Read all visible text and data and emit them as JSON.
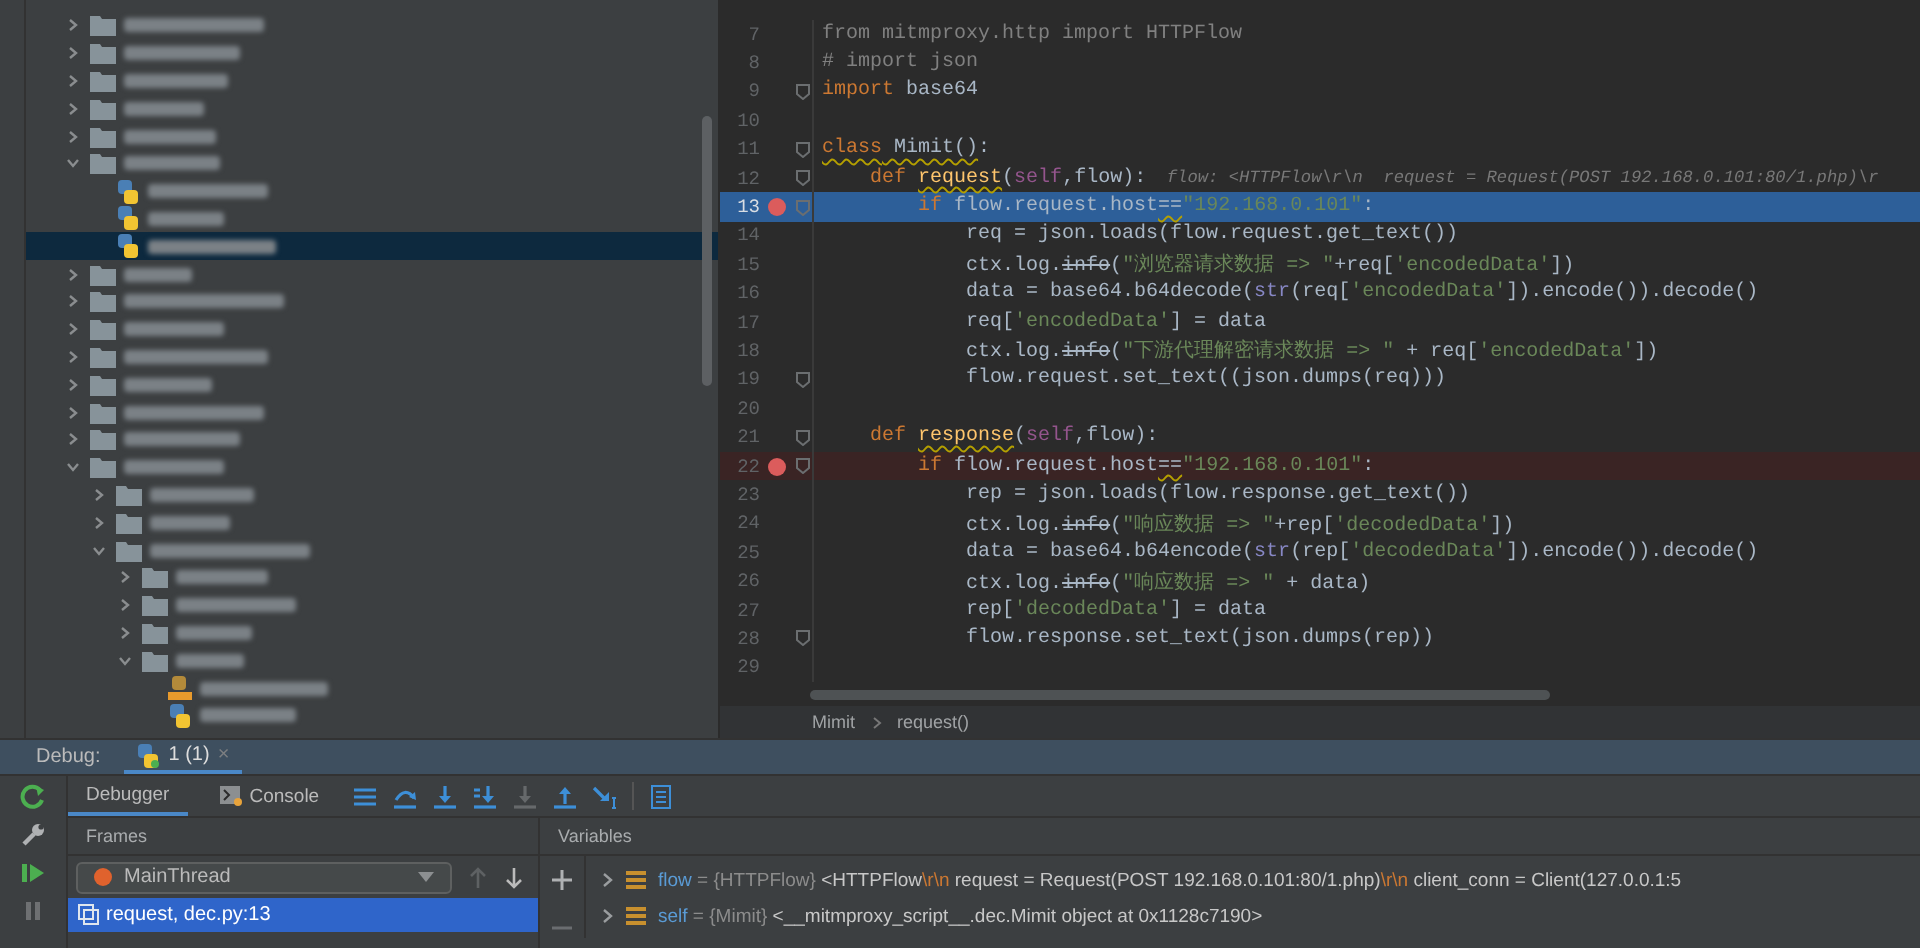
{
  "project_tree": {
    "items": [
      {
        "kind": "folder",
        "expanded": false,
        "selected": false
      },
      {
        "kind": "folder",
        "expanded": false,
        "selected": false
      },
      {
        "kind": "folder",
        "expanded": false,
        "selected": false
      },
      {
        "kind": "folder",
        "expanded": false,
        "selected": false
      },
      {
        "kind": "folder",
        "expanded": false,
        "selected": false
      },
      {
        "kind": "folder",
        "expanded": true,
        "selected": false,
        "children": [
          {
            "kind": "python-file",
            "selected": false
          },
          {
            "kind": "python-file",
            "selected": false
          },
          {
            "kind": "python-file",
            "selected": true
          }
        ]
      },
      {
        "kind": "folder",
        "expanded": false,
        "selected": false
      },
      {
        "kind": "folder",
        "expanded": false,
        "selected": false
      },
      {
        "kind": "folder",
        "expanded": false,
        "selected": false
      },
      {
        "kind": "folder",
        "expanded": false,
        "selected": false
      },
      {
        "kind": "folder",
        "expanded": false,
        "selected": false
      },
      {
        "kind": "folder",
        "expanded": false,
        "selected": false
      },
      {
        "kind": "folder",
        "expanded": false,
        "selected": false
      },
      {
        "kind": "folder",
        "expanded": true,
        "selected": false,
        "children": [
          {
            "kind": "folder",
            "expanded": false,
            "selected": false
          },
          {
            "kind": "folder",
            "expanded": false,
            "selected": false
          },
          {
            "kind": "folder",
            "expanded": true,
            "selected": false,
            "children": [
              {
                "kind": "folder",
                "expanded": false,
                "selected": false
              },
              {
                "kind": "folder",
                "expanded": false,
                "selected": false
              },
              {
                "kind": "folder",
                "expanded": false,
                "selected": false
              },
              {
                "kind": "folder",
                "expanded": true,
                "selected": false,
                "children": [
                  {
                    "kind": "module-file",
                    "selected": false
                  },
                  {
                    "kind": "python-file",
                    "selected": false
                  }
                ]
              }
            ]
          }
        ]
      }
    ]
  },
  "editor": {
    "lines": [
      {
        "number": "7",
        "breakpoint": false,
        "current": false,
        "fold": false,
        "tokens": [
          {
            "t": "from mitmproxy.http import HTTPFlow",
            "kind": "unused"
          }
        ]
      },
      {
        "number": "8",
        "breakpoint": false,
        "current": false,
        "fold": false,
        "tokens": [
          {
            "t": "# import json",
            "kind": "comment"
          }
        ]
      },
      {
        "number": "9",
        "breakpoint": false,
        "current": false,
        "fold": true,
        "tokens": [
          {
            "t": "import",
            "kind": "kw"
          },
          {
            "t": " base64",
            "kind": "plain"
          }
        ]
      },
      {
        "number": "10",
        "breakpoint": false,
        "current": false,
        "fold": false
      },
      {
        "number": "11",
        "breakpoint": false,
        "current": false,
        "fold": true,
        "tokens": [
          {
            "t": "class",
            "kind": "kw",
            "wavy": true
          },
          {
            "t": " Mimit()",
            "kind": "plain",
            "wavy": true
          },
          {
            "t": ":",
            "kind": "plain"
          }
        ]
      },
      {
        "number": "12",
        "breakpoint": false,
        "current": false,
        "fold": true,
        "tokens": [
          {
            "t": "    def ",
            "kind": "kw"
          },
          {
            "t": "request",
            "kind": "fn",
            "wavy": true
          },
          {
            "t": "(",
            "kind": "plain"
          },
          {
            "t": "self",
            "kind": "self"
          },
          {
            "t": ",flow):",
            "kind": "plain"
          },
          {
            "t": "  flow: <HTTPFlow\\r\\n  request = Request(POST 192.168.0.101:80/1.php)\\r",
            "kind": "hint"
          }
        ]
      },
      {
        "number": "13",
        "breakpoint": true,
        "current": true,
        "fold": true,
        "tokens": [
          {
            "t": "        if",
            "kind": "kw"
          },
          {
            "t": " flow.request.host",
            "kind": "plain"
          },
          {
            "t": "==",
            "kind": "plain",
            "wavy": true
          },
          {
            "t": "\"192.168.0.101\"",
            "kind": "str"
          },
          {
            "t": ":",
            "kind": "plain"
          }
        ]
      },
      {
        "number": "14",
        "breakpoint": false,
        "current": false,
        "fold": false,
        "tokens": [
          {
            "t": "            req = json.loads(flow.request.get_text())",
            "kind": "plain"
          }
        ]
      },
      {
        "number": "15",
        "breakpoint": false,
        "current": false,
        "fold": false,
        "tokens": [
          {
            "t": "            ctx.log.",
            "kind": "plain"
          },
          {
            "t": "info",
            "kind": "strike"
          },
          {
            "t": "(",
            "kind": "plain"
          },
          {
            "t": "\"浏览器请求数据 => \"",
            "kind": "str"
          },
          {
            "t": "+req[",
            "kind": "plain"
          },
          {
            "t": "'encodedData'",
            "kind": "str"
          },
          {
            "t": "])",
            "kind": "plain"
          }
        ]
      },
      {
        "number": "16",
        "breakpoint": false,
        "current": false,
        "fold": false,
        "tokens": [
          {
            "t": "            data = base64.b64decode(",
            "kind": "plain"
          },
          {
            "t": "str",
            "kind": "builtin"
          },
          {
            "t": "(req[",
            "kind": "plain"
          },
          {
            "t": "'encodedData'",
            "kind": "str"
          },
          {
            "t": "]).encode()).decode()",
            "kind": "plain"
          }
        ]
      },
      {
        "number": "17",
        "breakpoint": false,
        "current": false,
        "fold": false,
        "tokens": [
          {
            "t": "            req[",
            "kind": "plain"
          },
          {
            "t": "'encodedData'",
            "kind": "str"
          },
          {
            "t": "] = data",
            "kind": "plain"
          }
        ]
      },
      {
        "number": "18",
        "breakpoint": false,
        "current": false,
        "fold": false,
        "tokens": [
          {
            "t": "            ctx.log.",
            "kind": "plain"
          },
          {
            "t": "info",
            "kind": "strike"
          },
          {
            "t": "(",
            "kind": "plain"
          },
          {
            "t": "\"下游代理解密请求数据 => \"",
            "kind": "str"
          },
          {
            "t": " + req[",
            "kind": "plain"
          },
          {
            "t": "'encodedData'",
            "kind": "str"
          },
          {
            "t": "])",
            "kind": "plain"
          }
        ]
      },
      {
        "number": "19",
        "breakpoint": false,
        "current": false,
        "fold": true,
        "tokens": [
          {
            "t": "            flow.request.set_text((json.dumps(req)))",
            "kind": "plain"
          }
        ]
      },
      {
        "number": "20",
        "breakpoint": false,
        "current": false,
        "fold": false
      },
      {
        "number": "21",
        "breakpoint": false,
        "current": false,
        "fold": true,
        "tokens": [
          {
            "t": "    def ",
            "kind": "kw"
          },
          {
            "t": "response",
            "kind": "fn",
            "wavy": true
          },
          {
            "t": "(",
            "kind": "plain"
          },
          {
            "t": "self",
            "kind": "self"
          },
          {
            "t": ",flow):",
            "kind": "plain"
          }
        ]
      },
      {
        "number": "22",
        "breakpoint": true,
        "current": false,
        "fold": true,
        "tokens": [
          {
            "t": "        if",
            "kind": "kw"
          },
          {
            "t": " flow.request.host",
            "kind": "plain"
          },
          {
            "t": "==",
            "kind": "plain",
            "wavy": true
          },
          {
            "t": "\"192.168.0.101\"",
            "kind": "str"
          },
          {
            "t": ":",
            "kind": "plain"
          }
        ]
      },
      {
        "number": "23",
        "breakpoint": false,
        "current": false,
        "fold": false,
        "tokens": [
          {
            "t": "            rep = json.loads(flow.response.get_text())",
            "kind": "plain"
          }
        ]
      },
      {
        "number": "24",
        "breakpoint": false,
        "current": false,
        "fold": false,
        "tokens": [
          {
            "t": "            ctx.log.",
            "kind": "plain"
          },
          {
            "t": "info",
            "kind": "strike"
          },
          {
            "t": "(",
            "kind": "plain"
          },
          {
            "t": "\"响应数据 => \"",
            "kind": "str"
          },
          {
            "t": "+rep[",
            "kind": "plain"
          },
          {
            "t": "'decodedData'",
            "kind": "str"
          },
          {
            "t": "])",
            "kind": "plain"
          }
        ]
      },
      {
        "number": "25",
        "breakpoint": false,
        "current": false,
        "fold": false,
        "tokens": [
          {
            "t": "            data = base64.b64encode(",
            "kind": "plain"
          },
          {
            "t": "str",
            "kind": "builtin"
          },
          {
            "t": "(rep[",
            "kind": "plain"
          },
          {
            "t": "'decodedData'",
            "kind": "str"
          },
          {
            "t": "]).encode()).decode()",
            "kind": "plain"
          }
        ]
      },
      {
        "number": "26",
        "breakpoint": false,
        "current": false,
        "fold": false,
        "tokens": [
          {
            "t": "            ctx.log.",
            "kind": "plain"
          },
          {
            "t": "info",
            "kind": "strike"
          },
          {
            "t": "(",
            "kind": "plain"
          },
          {
            "t": "\"响应数据 => \"",
            "kind": "str"
          },
          {
            "t": " + data)",
            "kind": "plain"
          }
        ]
      },
      {
        "number": "27",
        "breakpoint": false,
        "current": false,
        "fold": false,
        "tokens": [
          {
            "t": "            rep[",
            "kind": "plain"
          },
          {
            "t": "'decodedData'",
            "kind": "str"
          },
          {
            "t": "] = data",
            "kind": "plain"
          }
        ]
      },
      {
        "number": "28",
        "breakpoint": false,
        "current": false,
        "fold": true,
        "tokens": [
          {
            "t": "            flow.response.set_text(json.dumps(rep))",
            "kind": "plain"
          }
        ]
      },
      {
        "number": "29",
        "breakpoint": false,
        "current": false,
        "fold": false
      }
    ],
    "breadcrumbs": [
      "Mimit",
      "request()"
    ]
  },
  "debug": {
    "label": "Debug:",
    "session_tab": {
      "label": "1 (1)",
      "close": "×"
    },
    "tabs": [
      {
        "label": "Debugger",
        "selected": true
      },
      {
        "label": "Console",
        "selected": false
      }
    ],
    "toolbar": [
      {
        "kind": "frames",
        "disabled": false
      },
      {
        "kind": "step-over",
        "disabled": false
      },
      {
        "kind": "step-into",
        "disabled": false
      },
      {
        "kind": "step-into-my-code",
        "disabled": false
      },
      {
        "kind": "force-step-into",
        "disabled": true
      },
      {
        "kind": "step-out",
        "disabled": false
      },
      {
        "kind": "run-to-cursor",
        "disabled": false
      },
      {
        "kind": "table",
        "disabled": false
      }
    ],
    "frames_header": "Frames",
    "variables_header": "Variables",
    "thread": "MainThread",
    "frame_nav": [
      {
        "kind": "up",
        "disabled": true
      },
      {
        "kind": "down",
        "disabled": false
      }
    ],
    "frames": [
      {
        "label": "request, dec.py:13",
        "selected": true
      }
    ],
    "variables": [
      {
        "parts": [
          {
            "t": "flow",
            "kind": "name"
          },
          {
            "t": " = {HTTPFlow} ",
            "kind": "type"
          },
          {
            "t": "<HTTPFlow",
            "kind": "value"
          },
          {
            "t": "\\r\\n",
            "kind": "escape"
          },
          {
            "t": " request = Request(POST 192.168.0.101:80/1.php)",
            "kind": "value"
          },
          {
            "t": "\\r\\n",
            "kind": "escape"
          },
          {
            "t": " client_conn = Client(127.0.0.1:5",
            "kind": "value"
          }
        ]
      },
      {
        "parts": [
          {
            "t": "self",
            "kind": "name"
          },
          {
            "t": " = {Mimit} ",
            "kind": "type"
          },
          {
            "t": "<__mitmproxy_script__.dec.Mimit object at 0x1128c7190>",
            "kind": "value"
          }
        ]
      }
    ]
  }
}
